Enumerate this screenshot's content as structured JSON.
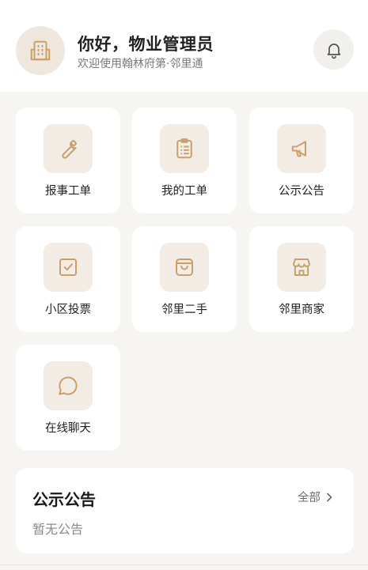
{
  "header": {
    "greeting": "你好，物业管理员",
    "subtitle": "欢迎使用翰林府第·邻里通",
    "avatar_icon": "building-icon",
    "bell_icon": "bell-icon"
  },
  "accent_color": "#c9a06b",
  "tiles": [
    {
      "label": "报事工单",
      "icon": "wrench-icon"
    },
    {
      "label": "我的工单",
      "icon": "clipboard-list-icon"
    },
    {
      "label": "公示公告",
      "icon": "megaphone-icon"
    },
    {
      "label": "小区投票",
      "icon": "checkbox-icon"
    },
    {
      "label": "邻里二手",
      "icon": "shopping-bag-icon"
    },
    {
      "label": "邻里商家",
      "icon": "storefront-icon"
    },
    {
      "label": "在线聊天",
      "icon": "chat-bubble-icon"
    }
  ],
  "notice": {
    "title": "公示公告",
    "more_label": "全部",
    "more_icon": "chevron-right-icon",
    "empty_text": "暂无公告"
  }
}
